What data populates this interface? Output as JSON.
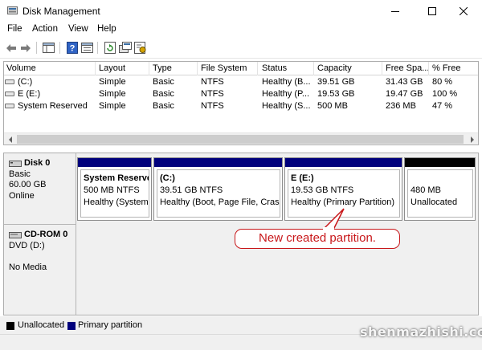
{
  "window": {
    "title": "Disk Management"
  },
  "menu": [
    "File",
    "Action",
    "View",
    "Help"
  ],
  "toolbar": {
    "icons": [
      "back-arrow-icon",
      "forward-arrow-icon",
      "console-tree-icon",
      "help-icon",
      "properties-icon",
      "refresh-icon",
      "rescan-disks-icon",
      "settings-icon"
    ]
  },
  "volume_list": {
    "headers": [
      "Volume",
      "Layout",
      "Type",
      "File System",
      "Status",
      "Capacity",
      "Free Spa...",
      "% Free"
    ],
    "rows": [
      [
        "(C:)",
        "Simple",
        "Basic",
        "NTFS",
        "Healthy (B...",
        "39.51 GB",
        "31.43 GB",
        "80 %"
      ],
      [
        "E (E:)",
        "Simple",
        "Basic",
        "NTFS",
        "Healthy (P...",
        "19.53 GB",
        "19.47 GB",
        "100 %"
      ],
      [
        "System Reserved",
        "Simple",
        "Basic",
        "NTFS",
        "Healthy (S...",
        "500 MB",
        "236 MB",
        "47 %"
      ]
    ]
  },
  "disks": [
    {
      "name": "Disk 0",
      "lines": [
        "Basic",
        "60.00 GB",
        "Online"
      ],
      "partitions": [
        {
          "name": "System Reserve",
          "size": "500 MB NTFS",
          "status": "Healthy (System,",
          "kind": "primary"
        },
        {
          "name": "(C:)",
          "size": "39.51 GB NTFS",
          "status": "Healthy (Boot, Page File, Crash",
          "kind": "primary"
        },
        {
          "name": "E  (E:)",
          "size": "19.53 GB NTFS",
          "status": "Healthy (Primary Partition)",
          "kind": "primary"
        },
        {
          "name": "",
          "size": "480 MB",
          "status": "Unallocated",
          "kind": "unallocated"
        }
      ]
    },
    {
      "name": "CD-ROM 0",
      "lines": [
        "DVD (D:)",
        "",
        "No Media"
      ]
    }
  ],
  "callout": {
    "text": "New created partition."
  },
  "legend": [
    {
      "label": "Unallocated",
      "color": "#000000"
    },
    {
      "label": "Primary partition",
      "color": "#00007c"
    }
  ],
  "watermark": "shenmazhishi.com",
  "colors": {
    "primary_bar": "#00007c",
    "unallocated_bar": "#000000",
    "callout": "#c8171a"
  }
}
